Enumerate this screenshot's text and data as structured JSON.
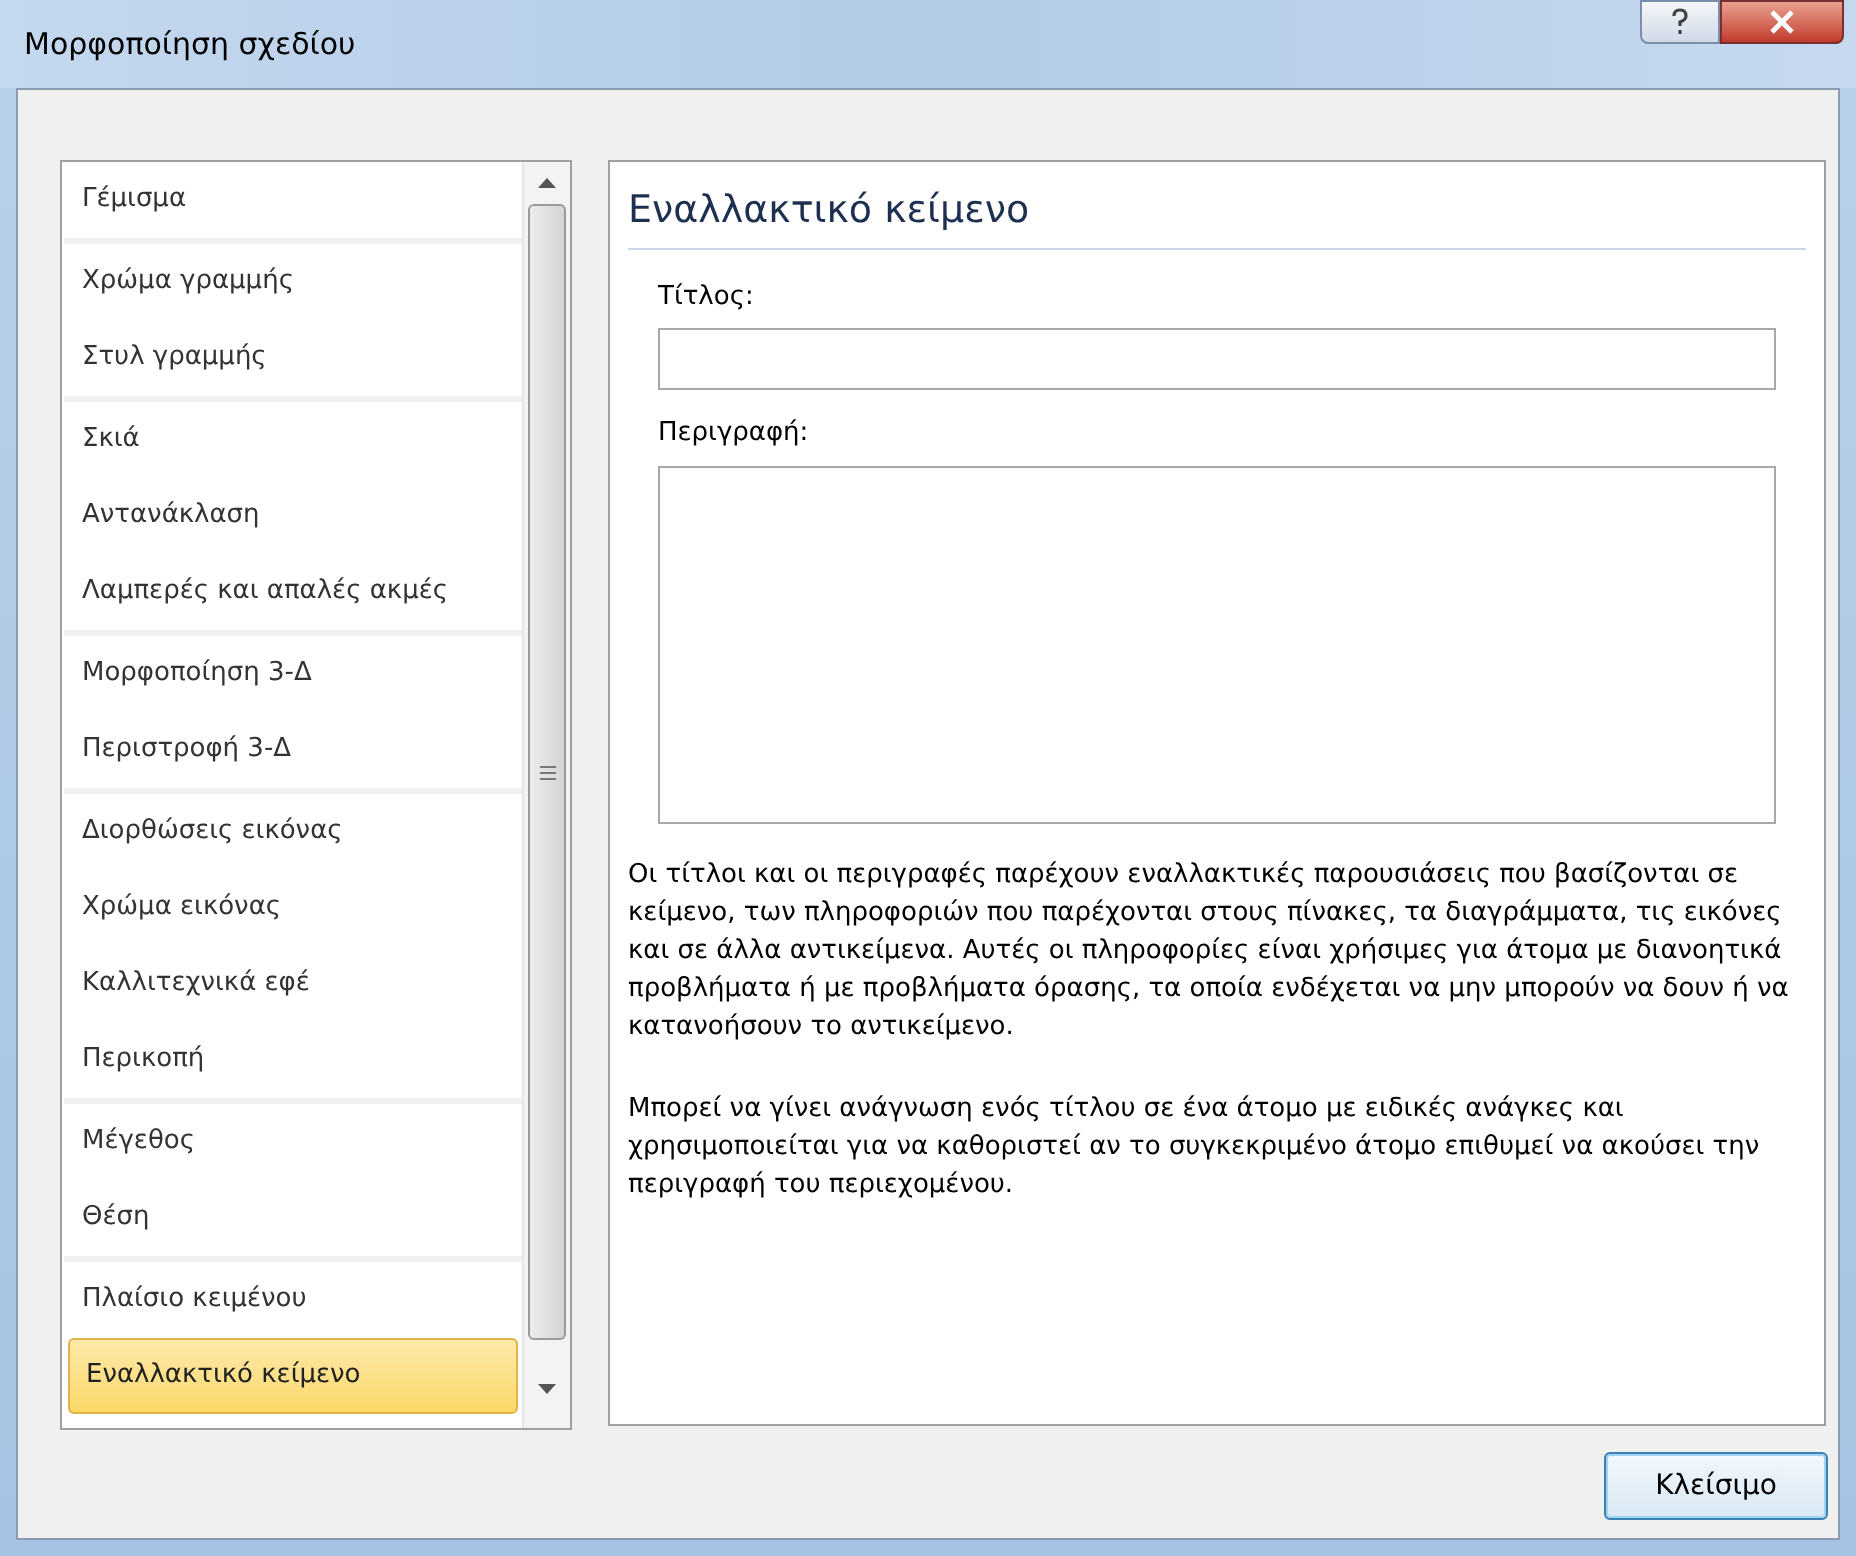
{
  "window": {
    "title": "Μορφοποίηση σχεδίου"
  },
  "sidebar": {
    "groups": [
      {
        "items": [
          {
            "label": "Γέμισμα",
            "selected": false
          }
        ]
      },
      {
        "items": [
          {
            "label": "Χρώμα γραμμής",
            "selected": false
          },
          {
            "label": "Στυλ γραμμής",
            "selected": false
          }
        ]
      },
      {
        "items": [
          {
            "label": "Σκιά",
            "selected": false
          },
          {
            "label": "Αντανάκλαση",
            "selected": false
          },
          {
            "label": "Λαμπερές και απαλές ακμές",
            "selected": false
          }
        ]
      },
      {
        "items": [
          {
            "label": "Μορφοποίηση 3-Δ",
            "selected": false
          },
          {
            "label": "Περιστροφή 3-Δ",
            "selected": false
          }
        ]
      },
      {
        "items": [
          {
            "label": "Διορθώσεις εικόνας",
            "selected": false
          },
          {
            "label": "Χρώμα εικόνας",
            "selected": false
          },
          {
            "label": "Καλλιτεχνικά εφέ",
            "selected": false
          },
          {
            "label": "Περικοπή",
            "selected": false
          }
        ]
      },
      {
        "items": [
          {
            "label": "Μέγεθος",
            "selected": false
          },
          {
            "label": "Θέση",
            "selected": false
          }
        ]
      },
      {
        "items": [
          {
            "label": "Πλαίσιο κειμένου",
            "selected": false
          },
          {
            "label": "Εναλλακτικό κείμενο",
            "selected": true
          }
        ]
      }
    ]
  },
  "panel": {
    "heading": "Εναλλακτικό κείμενο",
    "fields": [
      {
        "label": "Τίτλος:",
        "kind": "line"
      },
      {
        "label": "Περιγραφή:",
        "kind": "area"
      }
    ],
    "paragraphs": [
      "Οι τίτλοι και οι περιγραφές παρέχουν εναλλακτικές παρουσιάσεις που βασίζονται σε κείμενο, των πληροφοριών που παρέχονται στους πίνακες, τα διαγράμματα, τις εικόνες και σε άλλα αντικείμενα. Αυτές οι πληροφορίες είναι χρήσιμες για άτομα με διανοητικά προβλήματα ή με προβλήματα όρασης, τα οποία ενδέχεται να μην μπορούν να δουν ή να κατανοήσουν το αντικείμενο.",
      "Μπορεί να γίνει ανάγνωση ενός τίτλου σε ένα άτομο με ειδικές ανάγκες και χρησιμοποιείται για να καθοριστεί αν το συγκεκριμένο άτομο επιθυμεί να ακούσει την περιγραφή του περιεχομένου."
    ]
  },
  "buttons": [
    {
      "label": "Κλείσιμο"
    }
  ]
}
